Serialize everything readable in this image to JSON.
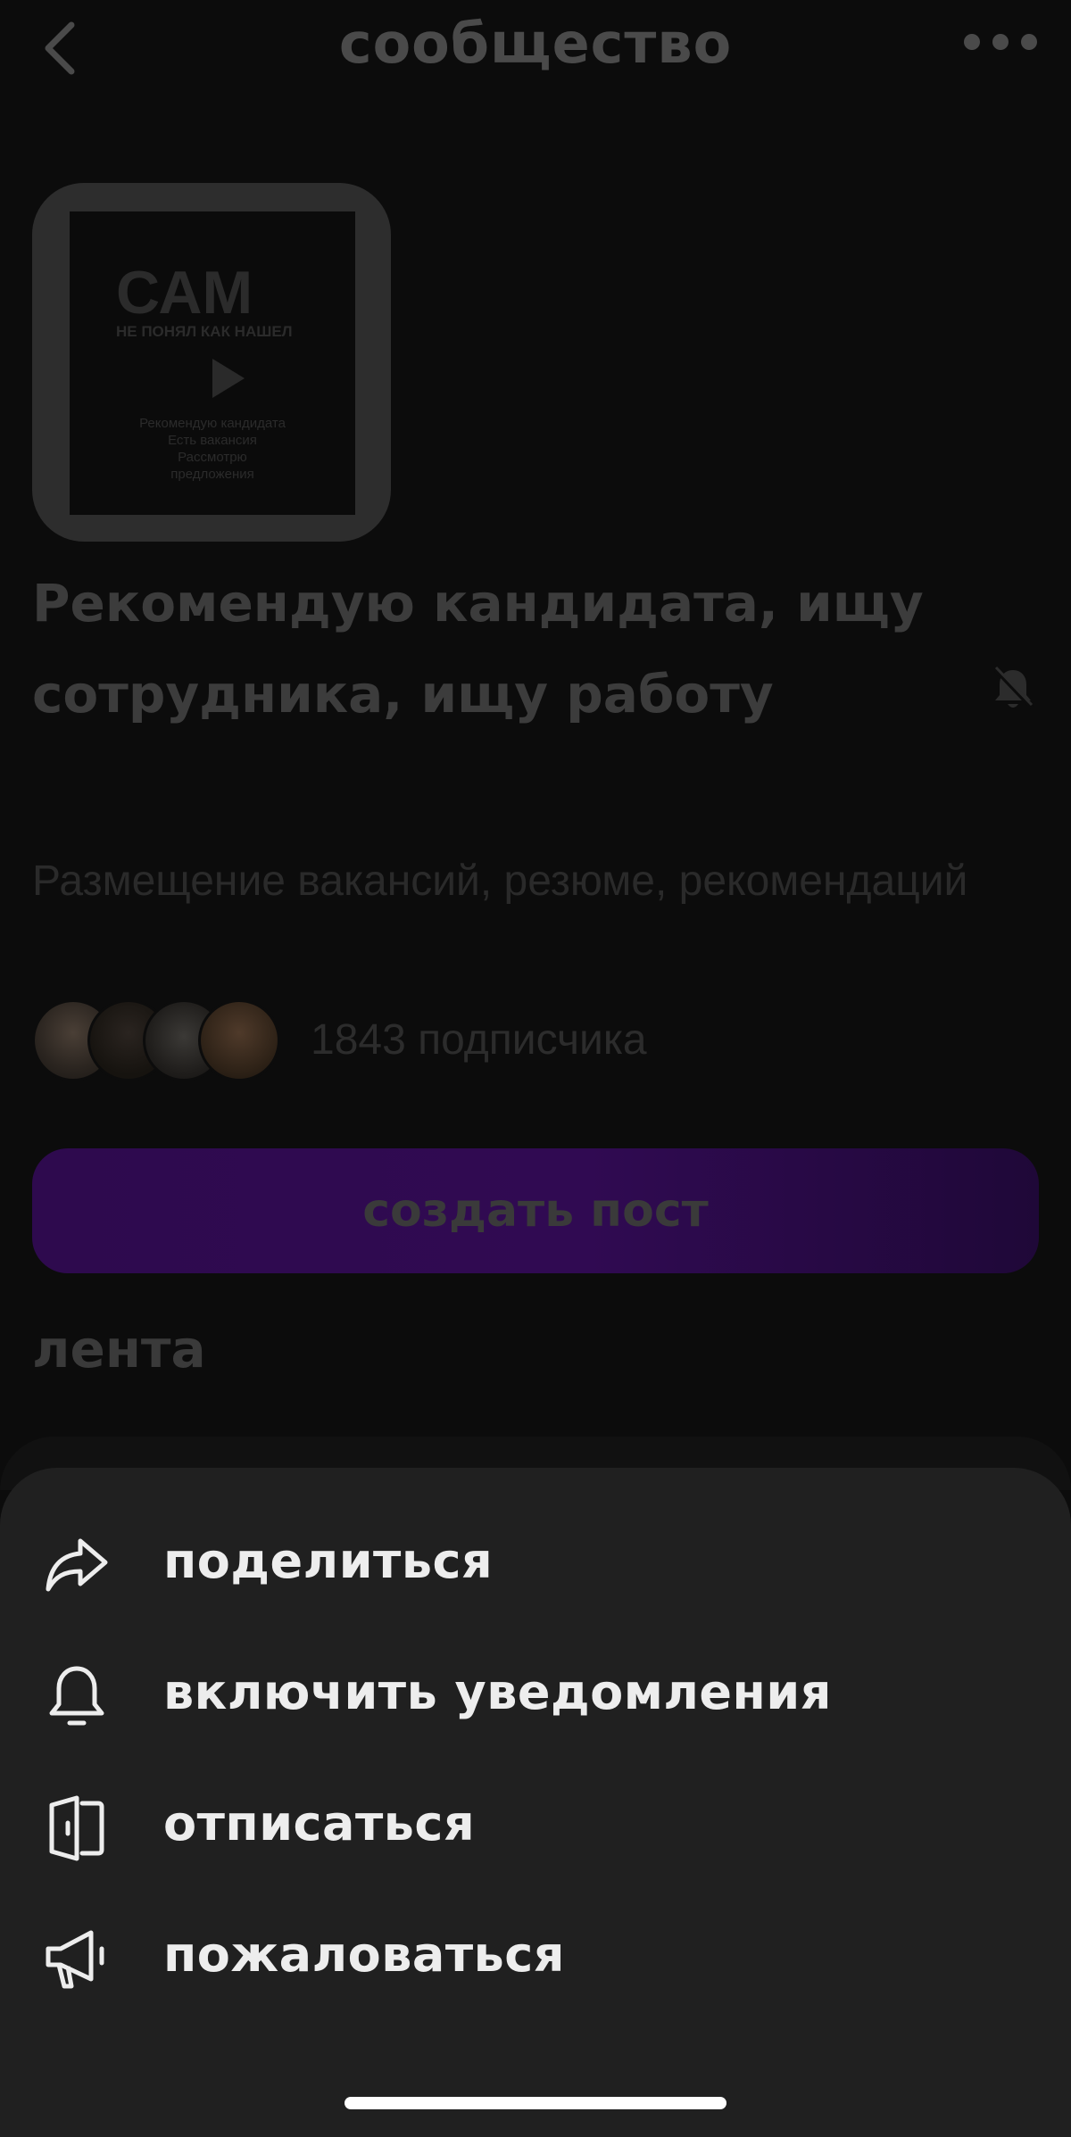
{
  "header": {
    "title": "сообщество",
    "back_icon": "chevron-left-icon",
    "more_icon": "more-horizontal-icon"
  },
  "cover": {
    "headline": "САМ",
    "subheadline": "НЕ ПОНЯЛ КАК НАШЕЛ",
    "lines": [
      "Рекомендую кандидата",
      "Есть вакансия",
      "Рассмотрю",
      "предложения"
    ]
  },
  "community": {
    "name": "Рекомендую кандидата, ищу сотрудника, ищу работу",
    "description": "Размещение вакансий, резюме, рекомендаций",
    "subscribers": "1843 подписчика",
    "notifications_icon": "bell-off-icon"
  },
  "actions": {
    "create_post": "создать пост"
  },
  "feed": {
    "title": "лента"
  },
  "sheet": {
    "items": [
      {
        "label": "поделиться",
        "icon": "share-icon"
      },
      {
        "label": "включить уведомления",
        "icon": "bell-icon"
      },
      {
        "label": "отписаться",
        "icon": "leave-door-icon"
      },
      {
        "label": "пожаловаться",
        "icon": "megaphone-icon"
      }
    ]
  },
  "colors": {
    "overlay": "#0c0c0c",
    "sheet": "#202020",
    "accent": "#2e0a4e"
  }
}
